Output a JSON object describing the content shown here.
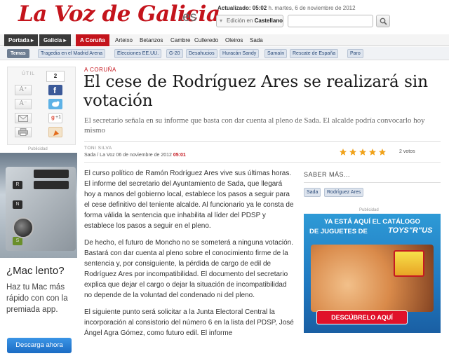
{
  "header": {
    "logo_text": "La Voz de Galicia",
    "logo_suffix": ".es",
    "updated_label": "Actualizado:",
    "updated_time": "05:02",
    "updated_rest": "h. martes, 6 de noviembre de 2012",
    "edition_prefix": "Edición en",
    "edition_value": "Castellano"
  },
  "nav": {
    "items": [
      "Portada",
      "Galicia",
      "A Coruña",
      "Arteixo",
      "Betanzos",
      "Cambre",
      "Culleredo",
      "Oleiros",
      "Sada"
    ],
    "active": "A Coruña"
  },
  "temas": {
    "label": "Temas",
    "tags": [
      "Tragedia en el Madrid Arena",
      "Elecciones EE.UU.",
      "G-20",
      "Desahucios",
      "Huracán Sandy",
      "Samaín",
      "Rescate de España",
      "Paro"
    ]
  },
  "tools": {
    "util_label": "ÚTIL",
    "font_up": "A⁺",
    "font_down": "A⁻",
    "share_count": "2",
    "gplus_label": "+1"
  },
  "left_ad": {
    "publicidad": "Publicidad",
    "keys": [
      "R",
      "N",
      "S"
    ],
    "headline": "¿Mac lento?",
    "body": "Haz tu Mac más rápido con con la premiada app.",
    "button": "Descarga ahora"
  },
  "article": {
    "section": "A CORUÑA",
    "headline": "El cese de Rodríguez Ares se realizará sin votación",
    "subhead": "El secretario señala en su informe que basta con dar cuenta al pleno de Sada. El alcalde podría convocarlo hoy mismo",
    "author": "TONI SILVA",
    "dateline": "Sada / La Voz  06 de noviembre de 2012",
    "time": "05:01",
    "rating": 5,
    "votes": "2 votos",
    "paragraphs": [
      "El curso político de Ramón Rodríguez Ares vive sus últimas horas. El informe del secretario del Ayuntamiento de Sada, que llegará hoy a manos del gobierno local, establece los pasos a seguir para el cese definitivo del teniente alcalde. Al funcionario ya le consta de forma válida la sentencia que inhabilita al líder del PDSP y establece los pasos a seguir en el pleno.",
      "De hecho, el futuro de Moncho no se someterá a ninguna votación. Bastará con dar cuenta al pleno sobre el conocimiento firme de la sentencia y, por consiguiente, la pérdida de cargo de edil de Rodríguez Ares por incompatibilidad. El documento del secretario explica que dejar el cargo o dejar la situación de incompatibilidad no depende de la voluntad del condenado ni del pleno.",
      "El siguiente punto será solicitar a la Junta Electoral Central la incorporación al consistorio del número 6 en la lista del PDSP, José Ángel Agra Gómez, como futuro edil. El informe"
    ]
  },
  "sidebar": {
    "saber_title": "SABER MÁS...",
    "tags": [
      "Sada",
      "Rodríguez Ares"
    ],
    "publicidad": "Publicidad",
    "ad_line1": "YA ESTÁ AQUÍ EL CATÁLOGO",
    "ad_line2": "DE JUGUETES DE",
    "ad_brand": "TOYS\"R\"US",
    "ad_cta": "DESCÚBRELO AQUÍ"
  },
  "colors": {
    "brand_red": "#c4141c",
    "link_blue": "#2a4a78",
    "star_orange": "#f0a21a"
  }
}
